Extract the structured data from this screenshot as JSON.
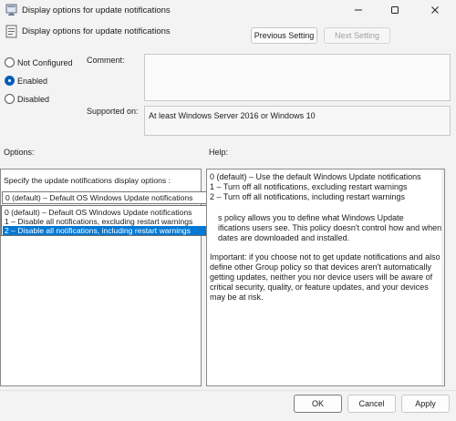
{
  "window": {
    "title": "Display options for update notifications",
    "minimize_icon": "minimize-icon",
    "maximize_icon": "maximize-icon",
    "close_icon": "close-icon"
  },
  "header": {
    "title": "Display options for update notifications",
    "previous_setting": "Previous Setting",
    "next_setting": "Next Setting"
  },
  "state": {
    "options": [
      "Not Configured",
      "Enabled",
      "Disabled"
    ],
    "selected": "Enabled"
  },
  "comment": {
    "label": "Comment:",
    "value": ""
  },
  "supported": {
    "label": "Supported on:",
    "value": "At least Windows Server 2016 or Windows 10"
  },
  "options_panel": {
    "label": "Options:",
    "prompt": "Specify the update notifications display options :",
    "combo_value": "0 (default) – Default OS Windows Update notifications",
    "dropdown_items": [
      "0 (default) – Default OS Windows Update notifications",
      "1 – Disable all notifications, excluding restart warnings",
      "2 – Disable all notifications, including restart warnings"
    ],
    "highlighted_index": 2
  },
  "help_panel": {
    "label": "Help:",
    "lines_1": "0 (default) – Use the default Windows Update notifications\n1 – Turn off all notifications, excluding restart warnings\n2 – Turn off all notifications, including restart warnings",
    "lines_2": "s policy allows you to define what Windows Update\nifications users see. This policy doesn't control how and when\ndates are downloaded and installed.",
    "lines_3": "Important: if you choose not to get update notifications and also\ndefine other Group policy so that devices aren't automatically\ngetting updates, neither you nor device users will be aware of\ncritical security, quality, or feature updates, and your devices\nmay be at risk."
  },
  "footer": {
    "ok": "OK",
    "cancel": "Cancel",
    "apply": "Apply"
  },
  "colors": {
    "accent": "#005fb8",
    "selection": "#0078d4"
  }
}
